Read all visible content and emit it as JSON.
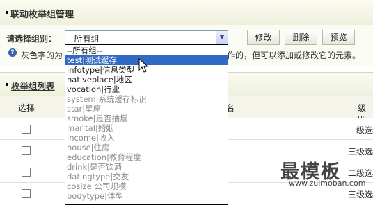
{
  "header": {
    "title": "联动枚举组管理"
  },
  "toolbar": {
    "select_label": "请选择组别：",
    "select_value": "--所有组--",
    "modify_label": "修改",
    "delete_label": "删除",
    "preview_label": "预览"
  },
  "help": {
    "text_left": "灰色字的为",
    "text_right": "作的，但可以添加或修改它的元素。"
  },
  "section": {
    "title": "枚举组列表"
  },
  "table": {
    "col_select": "选择",
    "col_partial": "名",
    "col_level": "级别",
    "rows": [
      {
        "level": "一级选"
      },
      {
        "level": "三级选"
      },
      {
        "level": "二级选"
      },
      {
        "level": "三级选"
      }
    ]
  },
  "dropdown": {
    "options": [
      {
        "label": "--所有组--",
        "state": "normal"
      },
      {
        "label": "test|测试缓存",
        "state": "selected"
      },
      {
        "label": "infotype|信息类型",
        "state": "normal"
      },
      {
        "label": "nativeplace|地区",
        "state": "normal"
      },
      {
        "label": "vocation|行业",
        "state": "normal"
      },
      {
        "label": "system|系统缓存标识",
        "state": "disabled"
      },
      {
        "label": "star|星座",
        "state": "disabled"
      },
      {
        "label": "smoke|是否抽烟",
        "state": "disabled"
      },
      {
        "label": "marital|婚姻",
        "state": "disabled"
      },
      {
        "label": "income|收入",
        "state": "disabled"
      },
      {
        "label": "house|住房",
        "state": "disabled"
      },
      {
        "label": "education|教育程度",
        "state": "disabled"
      },
      {
        "label": "drink|是否饮酒",
        "state": "disabled"
      },
      {
        "label": "datingtype|交友",
        "state": "disabled"
      },
      {
        "label": "cosize|公司规模",
        "state": "disabled"
      },
      {
        "label": "bodytype|体型",
        "state": "disabled"
      }
    ]
  },
  "watermark": {
    "main": "最模板",
    "sub": "www.zuimoban.com"
  }
}
